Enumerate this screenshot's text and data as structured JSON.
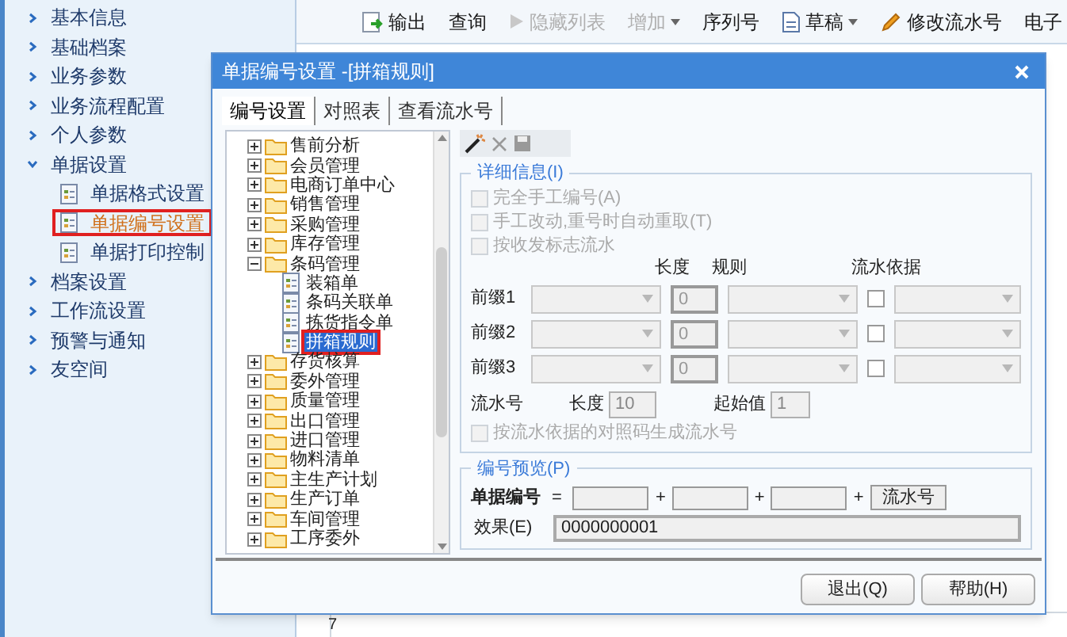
{
  "sidebar": {
    "items": [
      {
        "label": "基本信息",
        "expanded": false
      },
      {
        "label": "基础档案",
        "expanded": false
      },
      {
        "label": "业务参数",
        "expanded": false
      },
      {
        "label": "业务流程配置",
        "expanded": false
      },
      {
        "label": "个人参数",
        "expanded": false
      },
      {
        "label": "单据设置",
        "expanded": true,
        "children": [
          {
            "label": "单据格式设置",
            "selected": false
          },
          {
            "label": "单据编号设置",
            "selected": true
          },
          {
            "label": "单据打印控制",
            "selected": false
          }
        ]
      },
      {
        "label": "档案设置",
        "expanded": false
      },
      {
        "label": "工作流设置",
        "expanded": false
      },
      {
        "label": "预警与通知",
        "expanded": false
      },
      {
        "label": "友空间",
        "expanded": false
      }
    ]
  },
  "toolbar": {
    "items": [
      {
        "label": "输出",
        "kind": "export",
        "disabled": false
      },
      {
        "label": "查询",
        "kind": "plain",
        "disabled": false
      },
      {
        "label": "隐藏列表",
        "kind": "hide",
        "disabled": true
      },
      {
        "label": "增加",
        "kind": "dropdown",
        "disabled": true
      },
      {
        "label": "序列号",
        "kind": "plain",
        "disabled": false
      },
      {
        "label": "草稿",
        "kind": "draft",
        "disabled": false
      },
      {
        "label": "修改流水号",
        "kind": "edit",
        "disabled": false
      },
      {
        "label": "电子",
        "kind": "plain",
        "disabled": false
      }
    ]
  },
  "grid": {
    "row_numbers": [
      "7"
    ]
  },
  "dialog": {
    "title": "单据编号设置 -[拼箱规则]",
    "tabs": [
      {
        "label": "编号设置",
        "selected": true
      },
      {
        "label": "对照表",
        "selected": false
      },
      {
        "label": "查看流水号",
        "selected": false
      }
    ],
    "tree": {
      "items": [
        {
          "label": "售前分析",
          "expanded": false
        },
        {
          "label": "会员管理",
          "expanded": false
        },
        {
          "label": "电商订单中心",
          "expanded": false
        },
        {
          "label": "销售管理",
          "expanded": false
        },
        {
          "label": "采购管理",
          "expanded": false
        },
        {
          "label": "库存管理",
          "expanded": false
        },
        {
          "label": "条码管理",
          "expanded": true,
          "children": [
            {
              "label": "装箱单",
              "selected": false
            },
            {
              "label": "条码关联单",
              "selected": false
            },
            {
              "label": "拣货指令单",
              "selected": false
            },
            {
              "label": "拼箱规则",
              "selected": true
            }
          ]
        },
        {
          "label": "存货核算",
          "expanded": false
        },
        {
          "label": "委外管理",
          "expanded": false
        },
        {
          "label": "质量管理",
          "expanded": false
        },
        {
          "label": "出口管理",
          "expanded": false
        },
        {
          "label": "进口管理",
          "expanded": false
        },
        {
          "label": "物料清单",
          "expanded": false
        },
        {
          "label": "主生产计划",
          "expanded": false
        },
        {
          "label": "生产订单",
          "expanded": false
        },
        {
          "label": "车间管理",
          "expanded": false
        },
        {
          "label": "工序委外",
          "expanded": false
        }
      ]
    },
    "detail": {
      "legend": "详细信息(I)",
      "options": [
        {
          "label": "完全手工编号(A)",
          "checked": false,
          "disabled": true
        },
        {
          "label": "手工改动,重号时自动重取(T)",
          "checked": false,
          "disabled": true
        },
        {
          "label": "按收发标志流水",
          "checked": false,
          "disabled": true
        }
      ],
      "headers": [
        "长度",
        "规则",
        "流水依据"
      ],
      "prefixes": [
        {
          "label": "前缀1",
          "length": "0",
          "basis_checked": false
        },
        {
          "label": "前缀2",
          "length": "0",
          "basis_checked": false
        },
        {
          "label": "前缀3",
          "length": "0",
          "basis_checked": false
        }
      ],
      "serial": {
        "label": "流水号",
        "length_label": "长度",
        "length": "10",
        "start_label": "起始值",
        "start": "1"
      },
      "serial_option": {
        "label": "按流水依据的对照码生成流水号",
        "checked": false,
        "disabled": true
      }
    },
    "preview": {
      "legend": "编号预览(P)",
      "number_label": "单据编号",
      "equals": "=",
      "plus": "+",
      "serial_button": "流水号",
      "effect_label": "效果(E)",
      "effect": "0000000001"
    },
    "buttons": [
      "退出(Q)",
      "帮助(H)"
    ]
  }
}
